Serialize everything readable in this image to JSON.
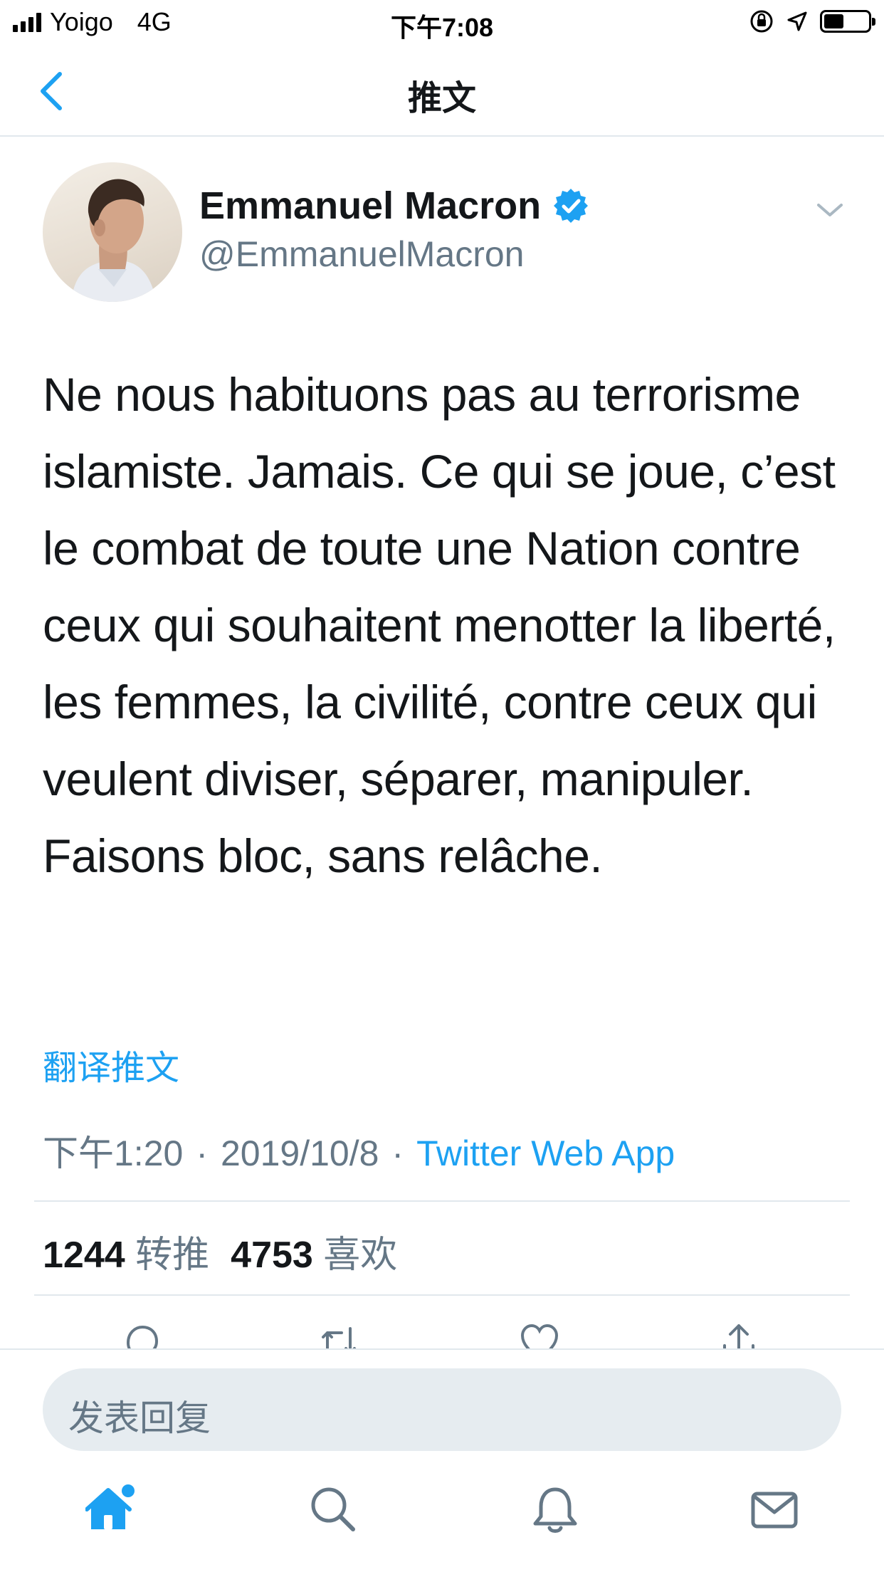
{
  "status_bar": {
    "carrier": "Yoigo",
    "network": "4G",
    "time": "下午7:08",
    "battery_level": 0.45
  },
  "nav": {
    "title": "推文",
    "back_icon": "chevron-left-icon"
  },
  "tweet": {
    "author_name": "Emmanuel Macron",
    "author_handle": "@EmmanuelMacron",
    "verified": true,
    "text": "Ne nous habituons pas au terrorisme islamiste. Jamais. Ce qui se joue, c’est le combat de toute une Nation contre ceux qui souhaitent menotter la liberté, les femmes, la civilité, contre ceux qui veulent diviser, séparer, manipuler. Faisons bloc, sans relâche.",
    "translate_label": "翻译推文",
    "time": "下午1:20",
    "date": "2019/10/8",
    "separator": "·",
    "source": "Twitter Web App",
    "retweets_count": "1244",
    "retweets_label": "转推",
    "likes_count": "4753",
    "likes_label": "喜欢"
  },
  "reply": {
    "placeholder": "发表回复"
  },
  "tabbar": {
    "items": [
      "home-icon",
      "search-icon",
      "notifications-icon",
      "messages-icon"
    ],
    "active": "home-icon"
  },
  "colors": {
    "accent": "#1da1f2",
    "text_primary": "#14171a",
    "text_secondary": "#657786",
    "divider": "#e1e8ed",
    "reply_bg": "#e6ecf0"
  }
}
